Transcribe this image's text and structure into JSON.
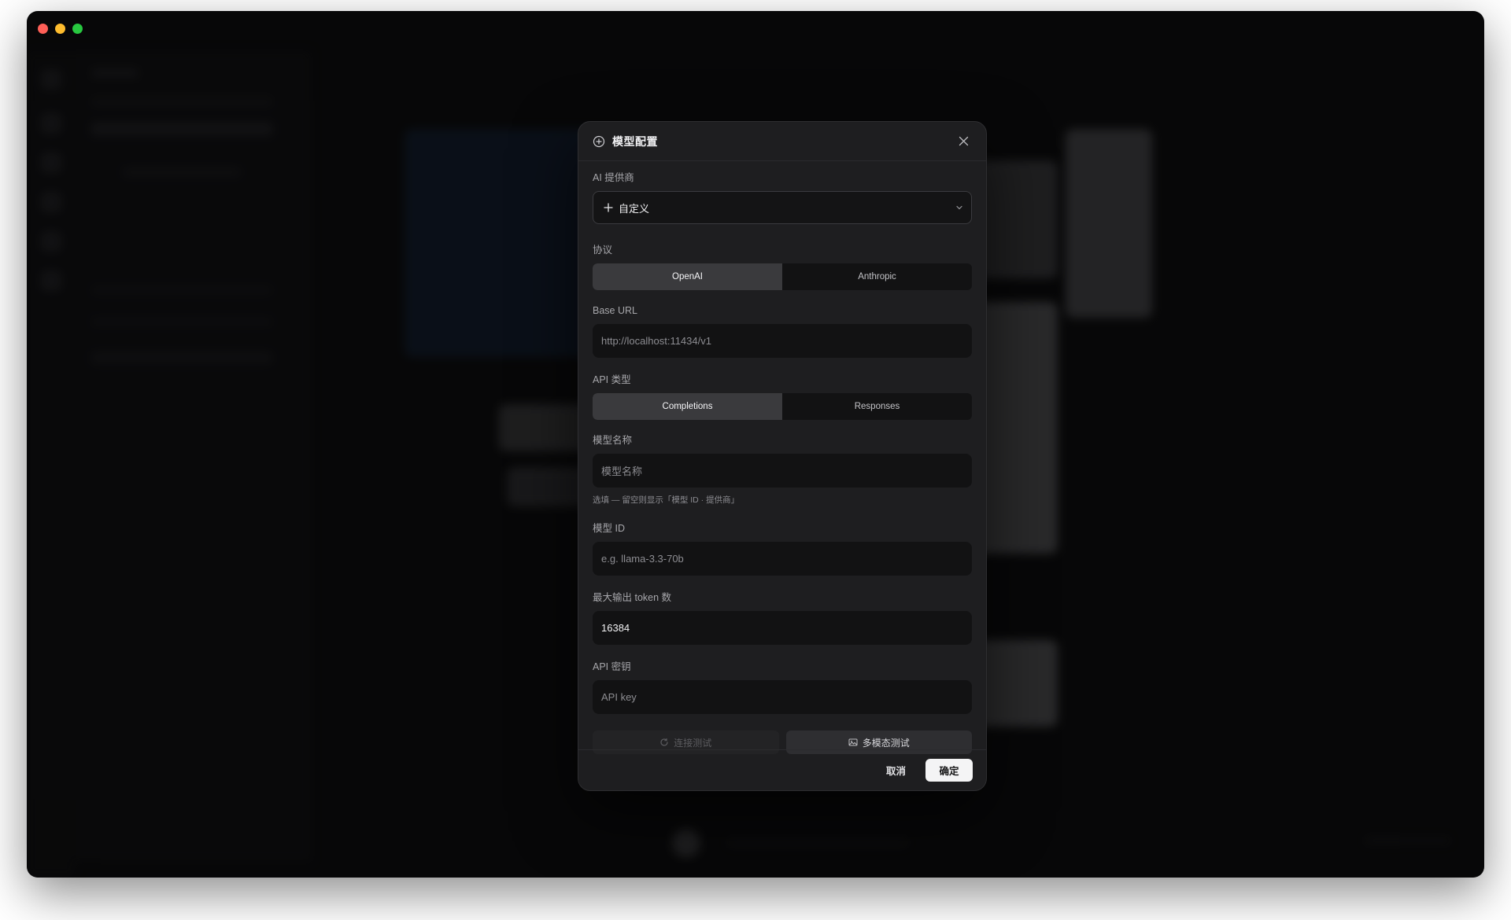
{
  "dialog": {
    "title": "模型配置",
    "provider": {
      "label": "AI 提供商",
      "value": "自定义"
    },
    "protocol": {
      "label": "协议",
      "options": [
        "OpenAI",
        "Anthropic"
      ],
      "selected": "OpenAI"
    },
    "base_url": {
      "label": "Base URL",
      "placeholder": "http://localhost:11434/v1"
    },
    "api_type": {
      "label": "API 类型",
      "options": [
        "Completions",
        "Responses"
      ],
      "selected": "Completions"
    },
    "model_name": {
      "label": "模型名称",
      "placeholder": "模型名称",
      "hint": "选填 — 留空则显示「模型 ID · 提供商」"
    },
    "model_id": {
      "label": "模型 ID",
      "placeholder": "e.g. llama-3.3-70b"
    },
    "max_tokens": {
      "label": "最大输出 token 数",
      "value": "16384"
    },
    "api_key": {
      "label": "API 密钥",
      "placeholder": "API key"
    },
    "test_connection_label": "连接测试",
    "test_multimodal_label": "多模态测试",
    "cancel_label": "取消",
    "confirm_label": "确定"
  },
  "icons": {
    "title": "plus-circle-icon",
    "close": "close-icon",
    "provider": "plus-icon",
    "dropdown": "chevron-down-icon",
    "test_connection": "refresh-icon",
    "test_multimodal": "image-icon"
  },
  "colors": {
    "dialog_bg": "#1e1e20",
    "confirm_button": "#f4f4f5",
    "traffic_red": "#fe5f57",
    "traffic_yellow": "#febc2e",
    "traffic_green": "#28c840"
  }
}
